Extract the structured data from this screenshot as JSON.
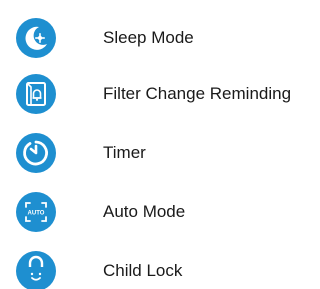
{
  "accent_color": "#1e8fd0",
  "menu": {
    "items": [
      {
        "label": "Sleep Mode",
        "icon": "sleep-mode-icon"
      },
      {
        "label": "Filter Change Reminding",
        "icon": "filter-reminder-icon"
      },
      {
        "label": "Timer",
        "icon": "timer-icon"
      },
      {
        "label": "Auto Mode",
        "icon": "auto-mode-icon",
        "icon_text": "AUTO"
      },
      {
        "label": "Child Lock",
        "icon": "child-lock-icon"
      }
    ]
  }
}
